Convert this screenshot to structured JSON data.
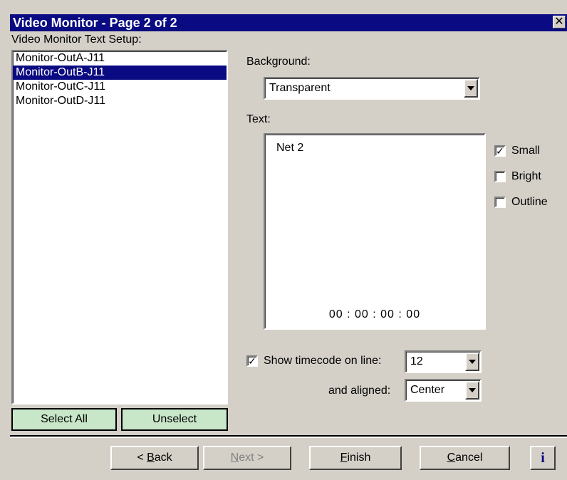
{
  "window": {
    "title": "Video Monitor - Page 2 of 2",
    "close_glyph": "✕"
  },
  "setup": {
    "label": "Video Monitor Text Setup:",
    "items": [
      {
        "label": "Monitor-OutA-J11",
        "selected": false
      },
      {
        "label": "Monitor-OutB-J11",
        "selected": true
      },
      {
        "label": "Monitor-OutC-J11",
        "selected": false
      },
      {
        "label": "Monitor-OutD-J11",
        "selected": false
      }
    ],
    "select_all_label": "Select All",
    "unselect_label": "Unselect"
  },
  "background": {
    "label": "Background:",
    "value": "Transparent"
  },
  "text": {
    "label": "Text:",
    "content": "Net 2",
    "timecode": "00 : 00 : 00 : 00"
  },
  "options": {
    "small": {
      "label": "Small",
      "checked": true
    },
    "bright": {
      "label": "Bright",
      "checked": false
    },
    "outline": {
      "label": "Outline",
      "checked": false
    }
  },
  "timecode": {
    "show_label": "Show timecode on line:",
    "show_checked": true,
    "line_value": "12",
    "aligned_label": "and aligned:",
    "aligned_value": "Center"
  },
  "footer": {
    "back_prefix": "< ",
    "back_key": "B",
    "back_rest": "ack",
    "next_key": "N",
    "next_rest": "ext >",
    "finish_key": "F",
    "finish_rest": "inish",
    "cancel_key": "C",
    "cancel_rest": "ancel",
    "info_label": "i"
  },
  "colors": {
    "title_bar": "#0a0a82",
    "selection": "#0a0a82",
    "face": "#d4d0c8",
    "green_button": "#c8e6c8"
  }
}
